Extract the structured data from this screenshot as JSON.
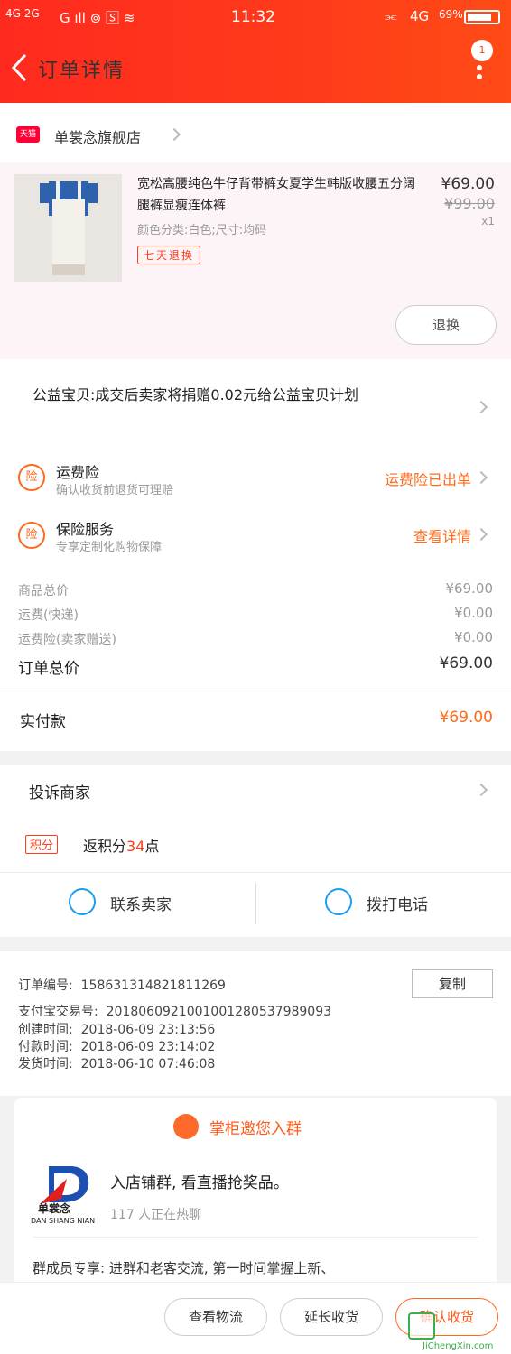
{
  "status_bar": {
    "network_left": "4G  2G",
    "time": "11:32",
    "network_right": "4G",
    "battery": "69%"
  },
  "header": {
    "title": "订单详情",
    "badge": "1"
  },
  "shop": {
    "platform_badge": "天猫",
    "name": "单裳念旗舰店"
  },
  "product": {
    "title": "宽松高腰纯色牛仔背带裤女夏学生韩版收腰五分阔腿裤显瘦连体裤",
    "sku": "颜色分类:白色;尺寸:均码",
    "tag": "七天退换",
    "price": "¥69.00",
    "original_price": "¥99.00",
    "quantity": "x1",
    "refund_button": "退换"
  },
  "charity": {
    "text": "公益宝贝:成交后卖家将捐赠0.02元给公益宝贝计划"
  },
  "insurance": [
    {
      "icon": "险",
      "title": "运费险",
      "subtitle": "确认收货前退货可理赔",
      "status": "运费险已出单"
    },
    {
      "icon": "险",
      "title": "保险服务",
      "subtitle": "专享定制化购物保障",
      "status": "查看详情"
    }
  ],
  "fees": [
    {
      "label": "商品总价",
      "value": "¥69.00"
    },
    {
      "label": "运费(快递)",
      "value": "¥0.00"
    },
    {
      "label": "运费险(卖家赠送)",
      "value": "¥0.00"
    }
  ],
  "order_total": {
    "label": "订单总价",
    "value": "¥69.00"
  },
  "paid": {
    "label": "实付款",
    "value": "¥69.00"
  },
  "complain": {
    "label": "投诉商家"
  },
  "points": {
    "tag": "积分",
    "prefix": "返积分",
    "value": "34",
    "suffix": "点"
  },
  "contact": {
    "seller": "联系卖家",
    "phone": "拨打电话"
  },
  "order_info": {
    "number_label": "订单编号:",
    "number": "1586313148218112​69",
    "copy": "复制",
    "alipay_label": "支付宝交易号:",
    "alipay": "2018060921001001280537989093",
    "created_label": "创建时间:",
    "created": "2018-06-09  23:13:56",
    "paid_label": "付款时间:",
    "paid": "2018-06-09  23:14:02",
    "shipped_label": "发货时间:",
    "shipped": "2018-06-10  07:46:08"
  },
  "group": {
    "heading": "掌柜邀您入群",
    "brand": "单裳念",
    "brand_en": "DAN SHANG NIAN",
    "title": "入店铺群, 看直播抢奖品。",
    "subtitle": "117 人正在热聊",
    "text": "群成员专享: 进群和老客交流, 第一时间掌握上新、"
  },
  "bottom": {
    "logistics": "查看物流",
    "extend": "延长收货",
    "confirm": "确认收货"
  },
  "watermark": "JiChengXin.com"
}
